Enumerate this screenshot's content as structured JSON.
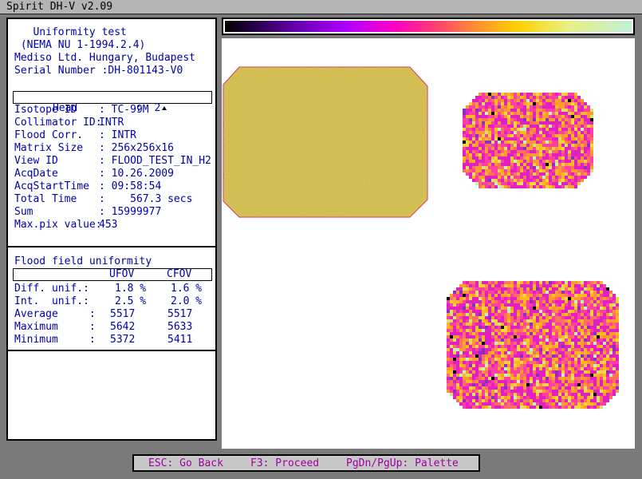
{
  "window": {
    "title": "Spirit DH-V v2.09"
  },
  "header": {
    "line1": "   Uniformity test",
    "line2": " (NEMA NU 1-1994.2.4)",
    "line3": "Mediso Ltd. Hungary, Budapest",
    "line4": "Serial Number :DH-801143-V0"
  },
  "info": {
    "head": {
      "label": "Head",
      "value": ":  2"
    },
    "rows": [
      {
        "label": "Isotope ID",
        "value": ": TC-99M"
      },
      {
        "label": "Collimator ID:",
        "value": "INTR"
      },
      {
        "label": "Flood Corr.",
        "value": ": INTR"
      },
      {
        "label": "Matrix Size",
        "value": ": 256x256x16"
      },
      {
        "label": "View ID",
        "value": ": FLOOD_TEST_IN_H2"
      },
      {
        "label": "AcqDate",
        "value": ": 10.26.2009"
      },
      {
        "label": "AcqStartTime",
        "value": ": 09:58:54"
      },
      {
        "label": "Total Time",
        "value": ":    567.3 secs"
      },
      {
        "label": "Sum",
        "value": ": 15999977"
      },
      {
        "label": "Max.pix value:",
        "value": "453"
      }
    ]
  },
  "uniformity": {
    "title": "Flood field uniformity",
    "col1": "UFOV",
    "col2": "CFOV",
    "rows": [
      {
        "label": "Diff. unif.:",
        "ufov": "1.8 %",
        "cfov": "1.6 %"
      },
      {
        "label": "Int.  unif.:",
        "ufov": "2.5 %",
        "cfov": "2.0 %"
      },
      {
        "label": "Average     :",
        "ufov": "5517",
        "cfov": "5517"
      },
      {
        "label": "Maximum     :",
        "ufov": "5642",
        "cfov": "5633"
      },
      {
        "label": "Minimum     :",
        "ufov": "5372",
        "cfov": "5411"
      }
    ]
  },
  "palette": {
    "colors": [
      "#000000",
      "#6a00b0",
      "#ff00c0",
      "#ff9030",
      "#ffd000",
      "#c0f0d8"
    ]
  },
  "images": {
    "flood_color": "#c8b440",
    "map_colors": [
      "#e020c0",
      "#ff40a0",
      "#ff7060",
      "#ff9a30",
      "#ffb820",
      "#ffd040",
      "#d8e070",
      "#c0f0c0",
      "#8a30c0",
      "#000000"
    ]
  },
  "status": {
    "esc": "ESC: Go Back",
    "f3": "F3: Proceed",
    "pg": "PgDn/PgUp: Palette"
  }
}
